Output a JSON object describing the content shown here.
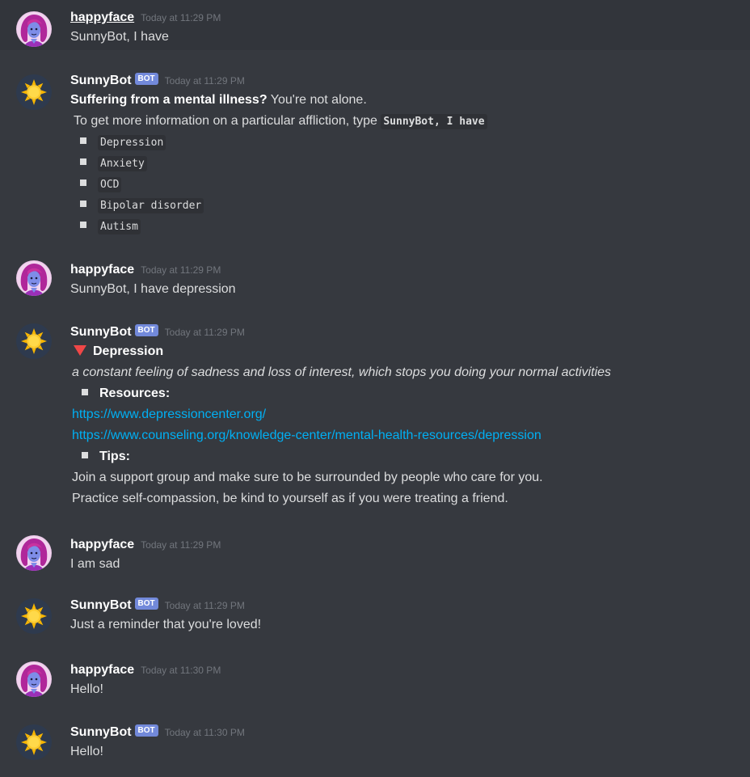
{
  "colors": {
    "background": "#36393f",
    "hover_background": "#32353b",
    "bot_tag": "#7289da",
    "link": "#00b0f4",
    "triangle": "#f04747"
  },
  "users": {
    "happyface": {
      "name": "happyface",
      "avatar": "pink-haired-character-avatar"
    },
    "sunnybot": {
      "name": "SunnyBot",
      "avatar": "sun-icon",
      "tag": "BOT"
    }
  },
  "messages": {
    "m1": {
      "author": "happyface",
      "timestamp": "Today at 11:29 PM",
      "text": "SunnyBot, I have"
    },
    "m2": {
      "author": "SunnyBot",
      "tag": "BOT",
      "timestamp": "Today at 11:29 PM",
      "heading_bold": "Suffering from a mental illness?",
      "heading_rest": " You're not alone.",
      "info_text": "To get more information on a particular affliction, type ",
      "info_code": "SunnyBot, I have",
      "list": [
        "Depression",
        "Anxiety",
        "OCD",
        "Bipolar disorder",
        "Autism"
      ]
    },
    "m3": {
      "author": "happyface",
      "timestamp": "Today at 11:29 PM",
      "text": "SunnyBot, I have depression"
    },
    "m4": {
      "author": "SunnyBot",
      "tag": "BOT",
      "timestamp": "Today at 11:29 PM",
      "title": "Depression",
      "description": "a constant feeling of sadness and loss of interest, which stops you doing your normal activities",
      "resources_label": "Resources:",
      "links": [
        "https://www.depressioncenter.org/",
        "https://www.counseling.org/knowledge-center/mental-health-resources/depression"
      ],
      "tips_label": "Tips:",
      "tips": [
        "Join a support group and make sure to be surrounded by people who care for you.",
        "Practice self-compassion, be kind to yourself as if you were treating a friend."
      ]
    },
    "m5": {
      "author": "happyface",
      "timestamp": "Today at 11:29 PM",
      "text": "I am sad"
    },
    "m6": {
      "author": "SunnyBot",
      "tag": "BOT",
      "timestamp": "Today at 11:29 PM",
      "text": "Just a reminder that you're loved!"
    },
    "m7": {
      "author": "happyface",
      "timestamp": "Today at 11:30 PM",
      "text": "Hello!"
    },
    "m8": {
      "author": "SunnyBot",
      "tag": "BOT",
      "timestamp": "Today at 11:30 PM",
      "text": "Hello!"
    }
  }
}
